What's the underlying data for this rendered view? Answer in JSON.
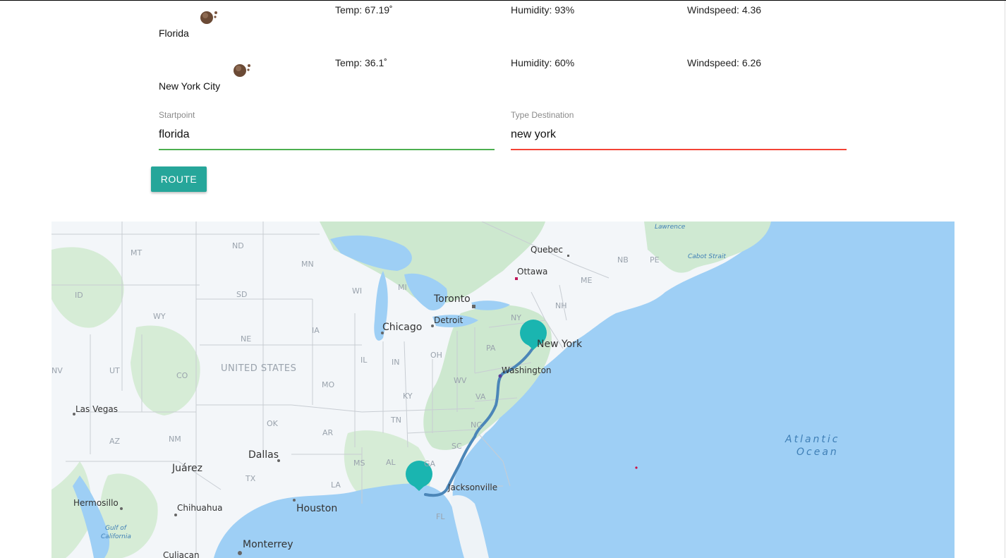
{
  "weather": [
    {
      "city": "Florida",
      "temp": "Temp: 67.19˚",
      "humidity": "Humidity: 93%",
      "windspeed": "Windspeed: 4.36",
      "icon": "cloudy-weather-icon"
    },
    {
      "city": "New York City",
      "temp": "Temp: 36.1˚",
      "humidity": "Humidity: 60%",
      "windspeed": "Windspeed: 6.26",
      "icon": "cloudy-weather-icon"
    }
  ],
  "form": {
    "start_label": "Startpoint",
    "start_value": "florida",
    "dest_label": "Type Destination",
    "dest_value": "new york",
    "route_button": "ROUTE"
  },
  "colors": {
    "accent": "#26a69a",
    "valid": "#4caf50",
    "invalid": "#f44336",
    "marker": "#1ab5b0",
    "route": "#4b86b8"
  },
  "map": {
    "states": [
      "MT",
      "ND",
      "MN",
      "ID",
      "SD",
      "WI",
      "MI",
      "WY",
      "NE",
      "IA",
      "NV",
      "UT",
      "CO",
      "IL",
      "IN",
      "OH",
      "PA",
      "NY",
      "NH",
      "ME",
      "MO",
      "KY",
      "WV",
      "VA",
      "AZ",
      "NM",
      "OK",
      "AR",
      "TN",
      "NC",
      "SC",
      "MS",
      "AL",
      "GA",
      "TX",
      "LA",
      "FL",
      "NB",
      "PE"
    ],
    "cities": [
      "Quebec",
      "Ottawa",
      "Toronto",
      "Detroit",
      "Chicago",
      "New York",
      "Washington",
      "Las Vegas",
      "Dallas",
      "Juárez",
      "Hermosillo",
      "Chihuahua",
      "Houston",
      "Jacksonville",
      "Monterrey",
      "Culiacan"
    ],
    "country": "UNITED STATES",
    "ocean": [
      "Atlantic",
      "Ocean"
    ],
    "water_labels": [
      "Lawrence",
      "Cabot Strait",
      "Gulf of",
      "California"
    ]
  }
}
